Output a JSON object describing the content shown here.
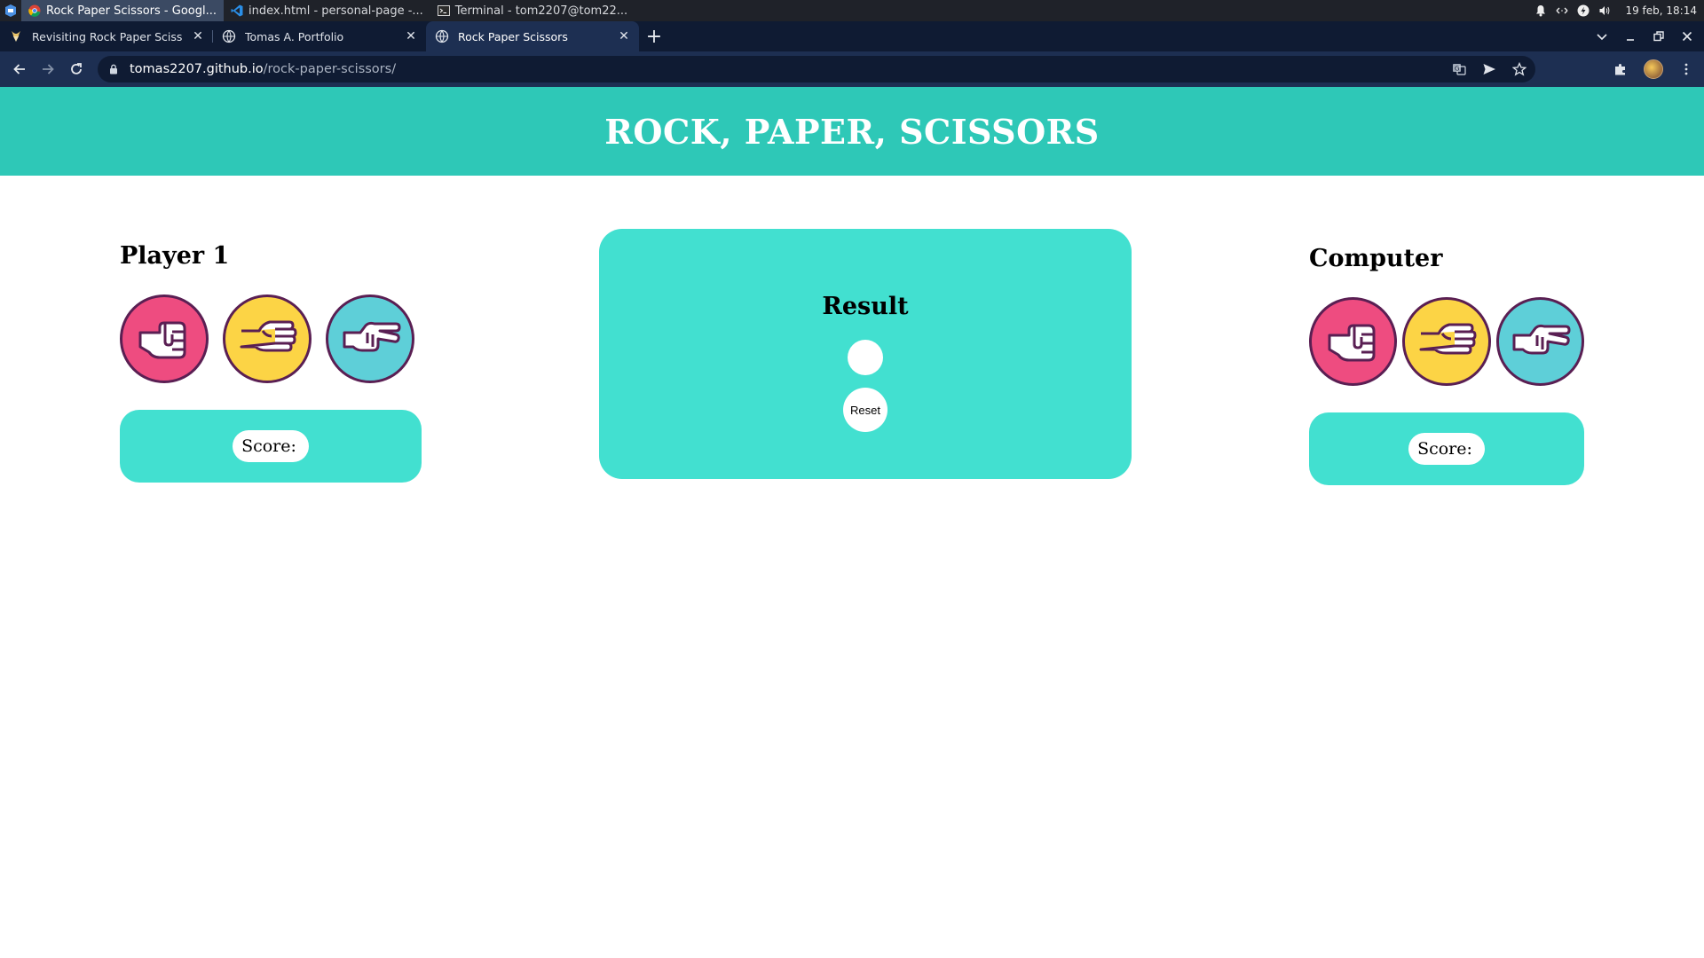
{
  "taskbar": {
    "tasks": [
      {
        "label": "Rock Paper Scissors - Googl...",
        "icon": "chrome-icon",
        "active": true
      },
      {
        "label": "index.html - personal-page -...",
        "icon": "vscode-icon",
        "active": false
      },
      {
        "label": "Terminal - tom2207@tom22...",
        "icon": "terminal-icon",
        "active": false
      }
    ],
    "clock": "19 feb, 18:14"
  },
  "browser": {
    "tabs": [
      {
        "label": "Revisiting Rock Paper Scissors",
        "icon": "odin-project-icon",
        "active": false
      },
      {
        "label": "Tomas A. Portfolio",
        "icon": "globe-icon",
        "active": false
      },
      {
        "label": "Rock Paper Scissors",
        "icon": "globe-icon",
        "active": true
      }
    ],
    "url_host": "tomas2207.github.io",
    "url_path": "/rock-paper-scissors/"
  },
  "page": {
    "title": "ROCK, PAPER, SCISSORS",
    "player": {
      "heading": "Player 1",
      "score_label": "Score:",
      "score_value": ""
    },
    "computer": {
      "heading": "Computer",
      "score_label": "Score:",
      "score_value": ""
    },
    "result": {
      "heading": "Result",
      "value": "",
      "reset_label": "Reset"
    },
    "choices": [
      "rock",
      "paper",
      "scissors"
    ],
    "colors": {
      "header": "#2ec8b7",
      "card": "#42e0d0",
      "rock": "#ee4c80",
      "paper": "#fcd445",
      "scissors": "#5ecfd8",
      "border": "#5a1f53"
    }
  }
}
